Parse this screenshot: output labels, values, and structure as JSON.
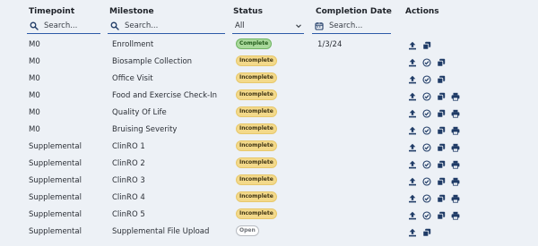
{
  "headers": {
    "timepoint": "Timepoint",
    "milestone": "Milestone",
    "status": "Status",
    "completion_date": "Completion Date",
    "actions": "Actions"
  },
  "filters": {
    "timepoint_placeholder": "Search...",
    "milestone_placeholder": "Search...",
    "status_value": "All",
    "completion_placeholder": "Search..."
  },
  "status_labels": {
    "complete": "Complete",
    "incomplete": "Incomplete",
    "open": "Open"
  },
  "rows": [
    {
      "timepoint": "M0",
      "milestone": "Enrollment",
      "status": "Complete",
      "date": "1/3/24",
      "actions": [
        "upload",
        "copy"
      ]
    },
    {
      "timepoint": "M0",
      "milestone": "Biosample Collection",
      "status": "Incomplete",
      "date": "",
      "actions": [
        "upload",
        "check",
        "copy"
      ]
    },
    {
      "timepoint": "M0",
      "milestone": "Office Visit",
      "status": "Incomplete",
      "date": "",
      "actions": [
        "upload",
        "check",
        "copy"
      ]
    },
    {
      "timepoint": "M0",
      "milestone": "Food and Exercise Check-In",
      "status": "Incomplete",
      "date": "",
      "actions": [
        "upload",
        "check",
        "copy",
        "print"
      ]
    },
    {
      "timepoint": "M0",
      "milestone": "Quality Of Life",
      "status": "Incomplete",
      "date": "",
      "actions": [
        "upload",
        "check",
        "copy",
        "print"
      ]
    },
    {
      "timepoint": "M0",
      "milestone": "Bruising Severity",
      "status": "Incomplete",
      "date": "",
      "actions": [
        "upload",
        "check",
        "copy",
        "print"
      ]
    },
    {
      "timepoint": "Supplemental",
      "milestone": "ClinRO 1",
      "status": "Incomplete",
      "date": "",
      "actions": [
        "upload",
        "check",
        "copy",
        "print"
      ]
    },
    {
      "timepoint": "Supplemental",
      "milestone": "ClinRO 2",
      "status": "Incomplete",
      "date": "",
      "actions": [
        "upload",
        "check",
        "copy",
        "print"
      ]
    },
    {
      "timepoint": "Supplemental",
      "milestone": "ClinRO 3",
      "status": "Incomplete",
      "date": "",
      "actions": [
        "upload",
        "check",
        "copy",
        "print"
      ]
    },
    {
      "timepoint": "Supplemental",
      "milestone": "ClinRO 4",
      "status": "Incomplete",
      "date": "",
      "actions": [
        "upload",
        "check",
        "copy",
        "print"
      ]
    },
    {
      "timepoint": "Supplemental",
      "milestone": "ClinRO 5",
      "status": "Incomplete",
      "date": "",
      "actions": [
        "upload",
        "check",
        "copy",
        "print"
      ]
    },
    {
      "timepoint": "Supplemental",
      "milestone": "Supplemental File Upload",
      "status": "Open",
      "date": "",
      "actions": [
        "upload",
        "copy"
      ]
    }
  ],
  "colors": {
    "background": "#edf1f6",
    "filter_underline": "#2d5aa8",
    "icon": "#1f3b66",
    "complete": "#a9d99b",
    "incomplete": "#f3d98a",
    "open": "#ffffff"
  }
}
